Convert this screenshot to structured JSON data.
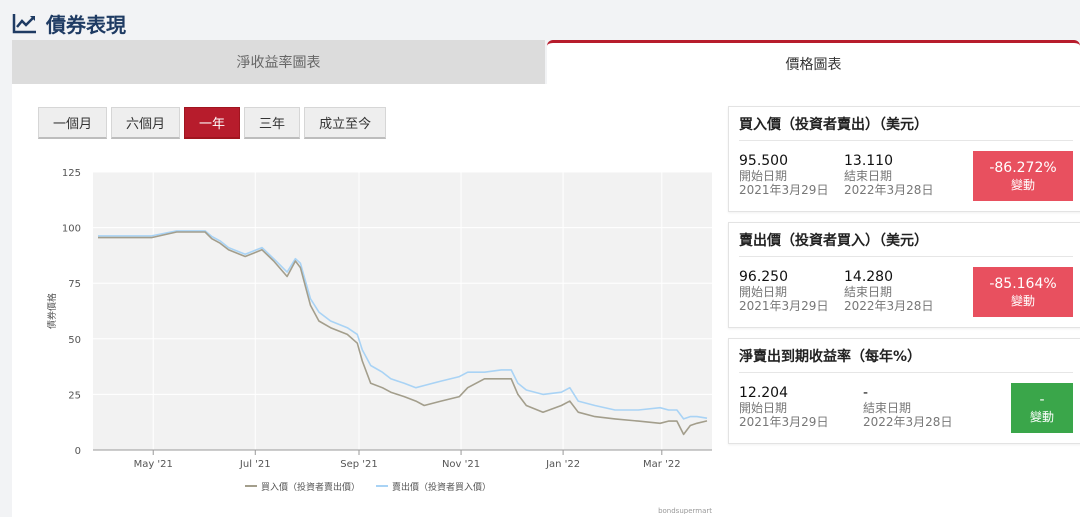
{
  "header": {
    "title": "債券表現"
  },
  "tabs": [
    {
      "label": "淨收益率圖表"
    },
    {
      "label": "價格圖表"
    }
  ],
  "range_buttons": [
    "一個月",
    "六個月",
    "一年",
    "三年",
    "成立至今"
  ],
  "colors": {
    "accent": "#b71c2c",
    "bid_line": "#a39e8c",
    "ask_line": "#a9d3f5",
    "negative": "#e8505f",
    "neutral": "#3aa64a"
  },
  "cards": [
    {
      "title": "買入價（投資者賣出）（美元）",
      "start_value": "95.500",
      "start_label": "開始日期",
      "start_date": "2021年3月29日",
      "end_value": "13.110",
      "end_label": "結束日期",
      "end_date": "2022年3月28日",
      "change_pct": "-86.272%",
      "change_label": "變動"
    },
    {
      "title": "賣出價（投資者買入）（美元）",
      "start_value": "96.250",
      "start_label": "開始日期",
      "start_date": "2021年3月29日",
      "end_value": "14.280",
      "end_label": "結束日期",
      "end_date": "2022年3月28日",
      "change_pct": "-85.164%",
      "change_label": "變動"
    },
    {
      "title": "淨賣出到期收益率（每年%）",
      "start_value": "12.204",
      "start_label": "開始日期",
      "start_date": "2021年3月29日",
      "end_value": "-",
      "end_label": "結束日期",
      "end_date": "2022年3月28日",
      "change_pct": "-",
      "change_label": "變動"
    }
  ],
  "chart_data": {
    "type": "line",
    "title": "",
    "xlabel": "",
    "ylabel": "債券價格",
    "ylim": [
      0,
      125
    ],
    "yticks": [
      0,
      25,
      50,
      75,
      100,
      125
    ],
    "xticks": [
      "May '21",
      "Jul '21",
      "Sep '21",
      "Nov '21",
      "Jan '22",
      "Mar '22"
    ],
    "x": [
      "2021-03-29",
      "2021-04-15",
      "2021-04-30",
      "2021-05-15",
      "2021-06-01",
      "2021-06-05",
      "2021-06-10",
      "2021-06-15",
      "2021-06-25",
      "2021-07-05",
      "2021-07-12",
      "2021-07-20",
      "2021-07-25",
      "2021-07-28",
      "2021-08-03",
      "2021-08-08",
      "2021-08-15",
      "2021-08-25",
      "2021-08-31",
      "2021-09-03",
      "2021-09-08",
      "2021-09-15",
      "2021-09-20",
      "2021-09-28",
      "2021-10-05",
      "2021-10-10",
      "2021-10-20",
      "2021-10-31",
      "2021-11-05",
      "2021-11-15",
      "2021-11-25",
      "2021-12-01",
      "2021-12-05",
      "2021-12-10",
      "2021-12-20",
      "2021-12-31",
      "2022-01-05",
      "2022-01-10",
      "2022-01-20",
      "2022-02-01",
      "2022-02-15",
      "2022-02-28",
      "2022-03-05",
      "2022-03-10",
      "2022-03-14",
      "2022-03-18",
      "2022-03-22",
      "2022-03-28"
    ],
    "series": [
      {
        "name": "買入價（投資者賣出價）",
        "values": [
          95.5,
          95.5,
          95.5,
          98,
          98,
          95,
          93,
          90,
          87,
          90,
          85,
          78,
          85,
          82,
          65,
          58,
          55,
          52,
          48,
          40,
          30,
          28,
          26,
          24,
          22,
          20,
          22,
          24,
          28,
          32,
          32,
          32,
          25,
          20,
          17,
          20,
          22,
          17,
          15,
          14,
          13,
          12,
          13,
          13,
          7,
          11,
          12,
          13.1
        ]
      },
      {
        "name": "賣出價（投資者買入價）",
        "values": [
          96.25,
          96.25,
          96.25,
          98.5,
          98.5,
          96,
          94,
          91,
          88,
          91,
          86,
          80,
          86,
          84,
          68,
          62,
          58,
          55,
          52,
          45,
          38,
          35,
          32,
          30,
          28,
          29,
          31,
          33,
          35,
          35,
          36,
          36,
          30,
          27,
          25,
          26,
          28,
          22,
          20,
          18,
          18,
          19,
          18,
          18,
          14,
          15,
          15,
          14.28
        ]
      }
    ],
    "legend_position": "bottom-center",
    "grid": true,
    "credit": "bondsupermart"
  }
}
